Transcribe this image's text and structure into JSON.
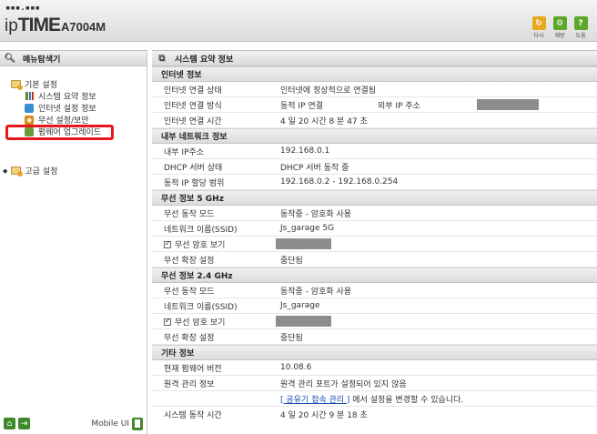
{
  "header": {
    "brand_dots": "▪▪▪.▪▪▪",
    "brand_ip": "ip",
    "brand_time": "TIME",
    "brand_model": "A7004M",
    "buttons": [
      {
        "label": "다시",
        "icon": "refresh-icon"
      },
      {
        "label": "재방",
        "icon": "setup-icon"
      },
      {
        "label": "도움",
        "icon": "help-icon"
      }
    ]
  },
  "sidebar": {
    "title": "메뉴탐색기",
    "tree": {
      "basic": "기본 설정",
      "basic_items": [
        "시스템 요약 정보",
        "인터넷 설정 정보",
        "무선 설정/보안",
        "펌웨어 업그레이드"
      ],
      "advanced": "고급 설정"
    },
    "footer": {
      "mobile_label": "Mobile UI"
    }
  },
  "main": {
    "title": "시스템 요약 정보",
    "internet": {
      "heading": "인터넷 정보",
      "rows": [
        {
          "k": "인터넷 연결 상태",
          "v": "인터넷에 정상적으로 연결됨"
        },
        {
          "k": "인터넷 연결 방식",
          "v": "동적 IP 연결",
          "k2": "외부 IP 주소"
        },
        {
          "k": "인터넷 연결 시간",
          "v": "4 일 20 시간 8 분 47 초"
        }
      ]
    },
    "lan": {
      "heading": "내부 네트워크 정보",
      "rows": [
        {
          "k": "내부 IP주소",
          "v": "192.168.0.1"
        },
        {
          "k": "DHCP 서버 상태",
          "v": "DHCP 서버 동작 중"
        },
        {
          "k": "동적 IP 할당 범위",
          "v": "192.168.0.2 -  192.168.0.254"
        }
      ]
    },
    "wifi5": {
      "heading": "무선 정보 5 GHz",
      "rows": [
        {
          "k": "무선 동작 모드",
          "v": "동작중 - 암호화 사용"
        },
        {
          "k": "네트워크 이름(SSID)",
          "v": "Js_garage 5G"
        },
        {
          "k": "무선 암호 보기"
        },
        {
          "k": "무선 확장 설정",
          "v": "중단됨"
        }
      ]
    },
    "wifi24": {
      "heading": "무선 정보 2.4 GHz",
      "rows": [
        {
          "k": "무선 동작 모드",
          "v": "동작중 - 암호화 사용"
        },
        {
          "k": "네트워크 이름(SSID)",
          "v": "Js_garage"
        },
        {
          "k": "무선 암호 보기"
        },
        {
          "k": "무선 확장 설정",
          "v": "중단됨"
        }
      ]
    },
    "etc": {
      "heading": "기타 정보",
      "rows": [
        {
          "k": "현재 펌웨어 버전",
          "v": "10.08.6"
        },
        {
          "k": "원격 관리 정보",
          "v": "원격 관리 포트가 설정되어 있지 않음"
        },
        {
          "k": "",
          "link": "[ 공유기 접속 관리 ]",
          "v_after": " 에서 설정을 변경할 수 있습니다."
        },
        {
          "k": "시스템 동작 시간",
          "v": "4 일 20 시간 9 분 18 초"
        }
      ]
    }
  }
}
